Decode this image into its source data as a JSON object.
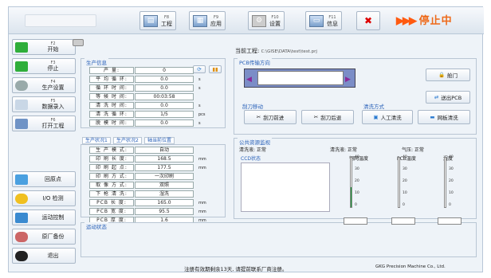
{
  "toolbar": {
    "items": [
      {
        "key": "F8",
        "label": "工程",
        "icon": "folder-icon"
      },
      {
        "key": "F9",
        "label": "应用",
        "icon": "grid-icon"
      },
      {
        "key": "F10",
        "label": "设置",
        "icon": "gear-icon"
      },
      {
        "key": "F11",
        "label": "信息",
        "icon": "id-card-icon"
      }
    ],
    "status_arrows": "▶▶▶",
    "status": "停止中"
  },
  "sidebar": {
    "items": [
      {
        "key": "F2",
        "label": "开始"
      },
      {
        "key": "F3",
        "label": "停止"
      },
      {
        "key": "F4",
        "label": "生产设置"
      },
      {
        "key": "F5",
        "label": "数据录入"
      },
      {
        "key": "F6",
        "label": "打开工程"
      }
    ],
    "bottom": [
      {
        "label": "回原点"
      },
      {
        "label": "I/O 检测"
      },
      {
        "label": "运动控制"
      },
      {
        "label": "原厂备份"
      },
      {
        "label": "退出"
      }
    ]
  },
  "project": {
    "label": "当前工程:",
    "path": "C:\\GISE\\DATA\\test\\test.prj"
  },
  "production": {
    "title": "生产信息",
    "rows": [
      {
        "label": "产 量:",
        "value": "0",
        "unit": ""
      },
      {
        "label": "平 均 循 环:",
        "value": "0.0",
        "unit": "s"
      },
      {
        "label": "循 环 时 间:",
        "value": "0.0",
        "unit": "s"
      },
      {
        "label": "等 候 时 间:",
        "value": "00:03:58",
        "unit": ""
      },
      {
        "label": "清 洗 时 间:",
        "value": "0.0",
        "unit": "s"
      },
      {
        "label": "清 洗 循 环:",
        "value": "1/5",
        "unit": "pcs"
      },
      {
        "label": "脱 模 时 间:",
        "value": "0.0",
        "unit": "s"
      }
    ]
  },
  "tabs": [
    "生产状况1",
    "生产状况2",
    "轴当前位置"
  ],
  "status2": {
    "rows": [
      {
        "label": "生 产 模 式:",
        "value": "自动",
        "unit": ""
      },
      {
        "label": "印 刷 长 度:",
        "value": "168.5",
        "unit": "mm"
      },
      {
        "label": "印 刷 起 点:",
        "value": "177.5",
        "unit": "mm"
      },
      {
        "label": "印 刷 方 式:",
        "value": "一次印刷",
        "unit": ""
      },
      {
        "label": "取 像 方 式:",
        "value": "双照",
        "unit": ""
      },
      {
        "label": "下 枪 清 洗:",
        "value": "湿洗",
        "unit": ""
      },
      {
        "label": "PCB 长 度:",
        "value": "165.0",
        "unit": "mm"
      },
      {
        "label": "PCB 宽 度:",
        "value": "95.5",
        "unit": "mm"
      },
      {
        "label": "PCB 厚 度:",
        "value": "1.6",
        "unit": "mm"
      }
    ]
  },
  "transport": {
    "title": "PCB传输方向",
    "door": "舱门",
    "pcb_out": "送出PCB"
  },
  "blade": {
    "title": "刮刀移动",
    "fwd": "刮刀前进",
    "back": "刮刀后退"
  },
  "clean": {
    "title": "清洗方式",
    "manual": "人工清洗",
    "bottom": "网板清洗"
  },
  "monitor": {
    "title": "公共资源监视",
    "clean_fluid": "清洗液: 正常",
    "clean_water": "清洗液: 正常",
    "air": "气压: 正常",
    "ccd": "CCD状态",
    "g1": "钢网温度",
    "g2": "PCB温度",
    "g3": "湿度",
    "ticks": [
      "40",
      "30",
      "20",
      "10",
      "0"
    ]
  },
  "motion": {
    "title": "运动状态"
  },
  "footer": {
    "notice": "注册有效期剩余13天, 请提前联系厂商注册。",
    "company": "GKG Precision Machine Co., Ltd."
  }
}
